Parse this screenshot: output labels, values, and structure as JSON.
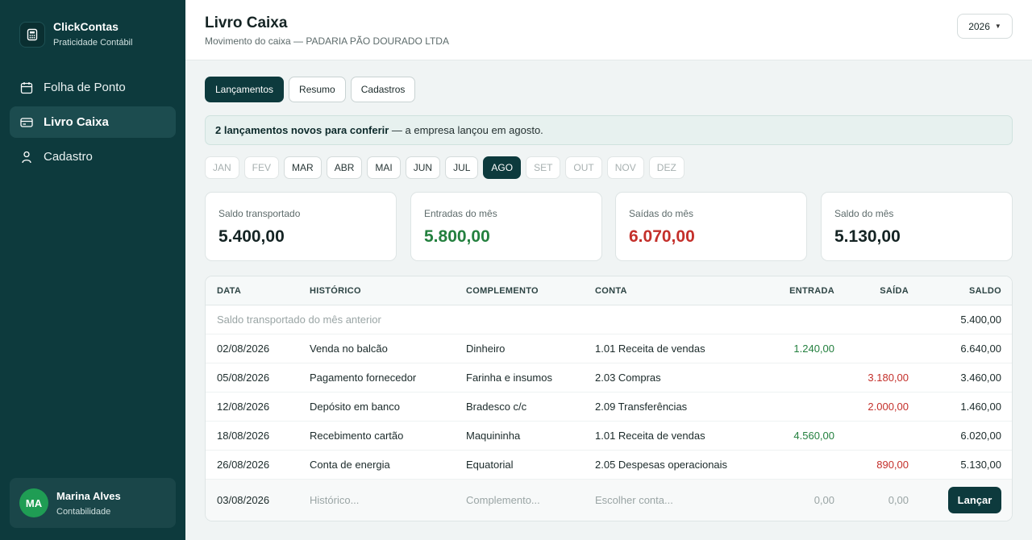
{
  "brand": {
    "name": "ClickContas",
    "subtitle": "Praticidade Contábil"
  },
  "sidebar": {
    "items": [
      {
        "label": "Folha de Ponto",
        "icon": "calendar-icon",
        "active": false
      },
      {
        "label": "Livro Caixa",
        "icon": "card-icon",
        "active": true
      },
      {
        "label": "Cadastro",
        "icon": "person-icon",
        "active": false
      }
    ]
  },
  "user": {
    "initials": "MA",
    "name": "Marina Alves",
    "role": "Contabilidade"
  },
  "header": {
    "title": "Livro Caixa",
    "subtitle": "Movimento do caixa — PADARIA PÃO DOURADO LTDA",
    "year": "2026"
  },
  "tabs": [
    {
      "label": "Lançamentos",
      "active": true
    },
    {
      "label": "Resumo",
      "active": false
    },
    {
      "label": "Cadastros",
      "active": false
    }
  ],
  "notice": {
    "bold": "2 lançamentos novos para conferir",
    "rest": " — a empresa lançou em agosto."
  },
  "months": [
    {
      "label": "JAN",
      "state": "disabled"
    },
    {
      "label": "FEV",
      "state": "disabled"
    },
    {
      "label": "MAR",
      "state": "normal"
    },
    {
      "label": "ABR",
      "state": "normal"
    },
    {
      "label": "MAI",
      "state": "normal"
    },
    {
      "label": "JUN",
      "state": "normal"
    },
    {
      "label": "JUL",
      "state": "normal"
    },
    {
      "label": "AGO",
      "state": "active"
    },
    {
      "label": "SET",
      "state": "disabled"
    },
    {
      "label": "OUT",
      "state": "disabled"
    },
    {
      "label": "NOV",
      "state": "disabled"
    },
    {
      "label": "DEZ",
      "state": "disabled"
    }
  ],
  "stats": [
    {
      "label": "Saldo transportado",
      "value": "5.400,00",
      "tone": "neutral"
    },
    {
      "label": "Entradas do mês",
      "value": "5.800,00",
      "tone": "green"
    },
    {
      "label": "Saídas do mês",
      "value": "6.070,00",
      "tone": "red"
    },
    {
      "label": "Saldo do mês",
      "value": "5.130,00",
      "tone": "neutral"
    }
  ],
  "table": {
    "columns": {
      "data": "DATA",
      "historico": "HISTÓRICO",
      "complemento": "COMPLEMENTO",
      "conta": "CONTA",
      "entrada": "ENTRADA",
      "saida": "SAÍDA",
      "saldo": "SALDO"
    },
    "carry": {
      "label": "Saldo transportado do mês anterior",
      "saldo": "5.400,00"
    },
    "rows": [
      {
        "data": "02/08/2026",
        "historico": "Venda no balcão",
        "complemento": "Dinheiro",
        "conta": "1.01 Receita de vendas",
        "entrada": "1.240,00",
        "saida": "",
        "saldo": "6.640,00"
      },
      {
        "data": "05/08/2026",
        "historico": "Pagamento fornecedor",
        "complemento": "Farinha e insumos",
        "conta": "2.03 Compras",
        "entrada": "",
        "saida": "3.180,00",
        "saldo": "3.460,00"
      },
      {
        "data": "12/08/2026",
        "historico": "Depósito em banco",
        "complemento": "Bradesco c/c",
        "conta": "2.09 Transferências",
        "entrada": "",
        "saida": "2.000,00",
        "saldo": "1.460,00"
      },
      {
        "data": "18/08/2026",
        "historico": "Recebimento cartão",
        "complemento": "Maquininha",
        "conta": "1.01 Receita de vendas",
        "entrada": "4.560,00",
        "saida": "",
        "saldo": "6.020,00"
      },
      {
        "data": "26/08/2026",
        "historico": "Conta de energia",
        "complemento": "Equatorial",
        "conta": "2.05 Despesas operacionais",
        "entrada": "",
        "saida": "890,00",
        "saldo": "5.130,00"
      }
    ],
    "input": {
      "data": "03/08/2026",
      "historico_placeholder": "Histórico...",
      "complemento_placeholder": "Complemento...",
      "conta_placeholder": "Escolher conta...",
      "entrada_placeholder": "0,00",
      "saida_placeholder": "0,00",
      "button": "Lançar"
    }
  },
  "colors": {
    "sidebar": "#0d3a3d",
    "accent": "#0d3a3d",
    "positive": "#24803f",
    "negative": "#c4302b"
  }
}
